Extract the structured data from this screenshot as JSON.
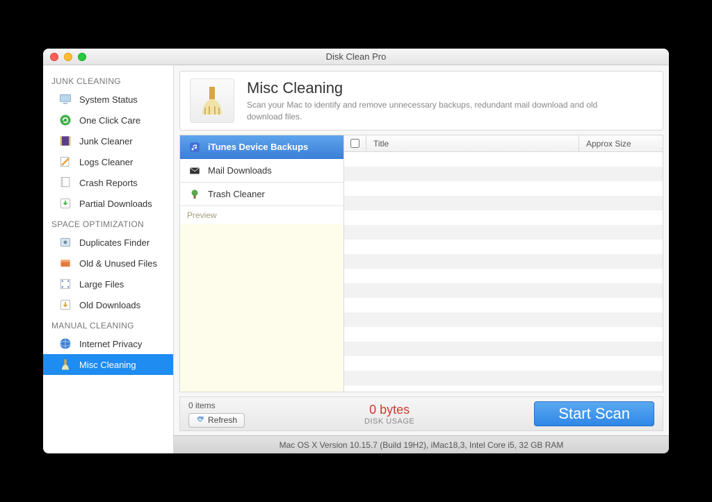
{
  "window": {
    "title": "Disk Clean Pro"
  },
  "sidebar": {
    "sections": [
      {
        "header": "JUNK CLEANING",
        "items": [
          {
            "label": "System Status",
            "icon": "monitor-icon"
          },
          {
            "label": "One Click Care",
            "icon": "refresh-circle-icon"
          },
          {
            "label": "Junk Cleaner",
            "icon": "film-strip-icon"
          },
          {
            "label": "Logs Cleaner",
            "icon": "pencil-note-icon"
          },
          {
            "label": "Crash Reports",
            "icon": "document-icon"
          },
          {
            "label": "Partial Downloads",
            "icon": "download-arrow-icon"
          }
        ]
      },
      {
        "header": "SPACE OPTIMIZATION",
        "items": [
          {
            "label": "Duplicates Finder",
            "icon": "gear-box-icon"
          },
          {
            "label": "Old & Unused Files",
            "icon": "drawer-icon"
          },
          {
            "label": "Large Files",
            "icon": "expand-icon"
          },
          {
            "label": "Old Downloads",
            "icon": "arrow-down-icon"
          }
        ]
      },
      {
        "header": "MANUAL CLEANING",
        "items": [
          {
            "label": "Internet Privacy",
            "icon": "globe-icon"
          },
          {
            "label": "Misc Cleaning",
            "icon": "broom-icon",
            "selected": true
          }
        ]
      }
    ]
  },
  "header": {
    "title": "Misc Cleaning",
    "description": "Scan your Mac to identify and remove unnecessary backups, redundant mail download and old download files."
  },
  "categories": {
    "items": [
      {
        "label": "iTunes Device Backups",
        "icon": "music-note-icon",
        "selected": true
      },
      {
        "label": "Mail Downloads",
        "icon": "envelope-icon"
      },
      {
        "label": "Trash Cleaner",
        "icon": "trash-tree-icon"
      }
    ],
    "preview_label": "Preview"
  },
  "results": {
    "columns": {
      "title": "Title",
      "size": "Approx Size"
    }
  },
  "footer": {
    "items_count": "0 items",
    "refresh_label": "Refresh",
    "bytes": "0 bytes",
    "disk_usage_label": "DISK USAGE",
    "start_scan_label": "Start Scan"
  },
  "sysinfo": "Mac OS X Version 10.15.7 (Build 19H2), iMac18,3, Intel Core i5, 32 GB RAM"
}
